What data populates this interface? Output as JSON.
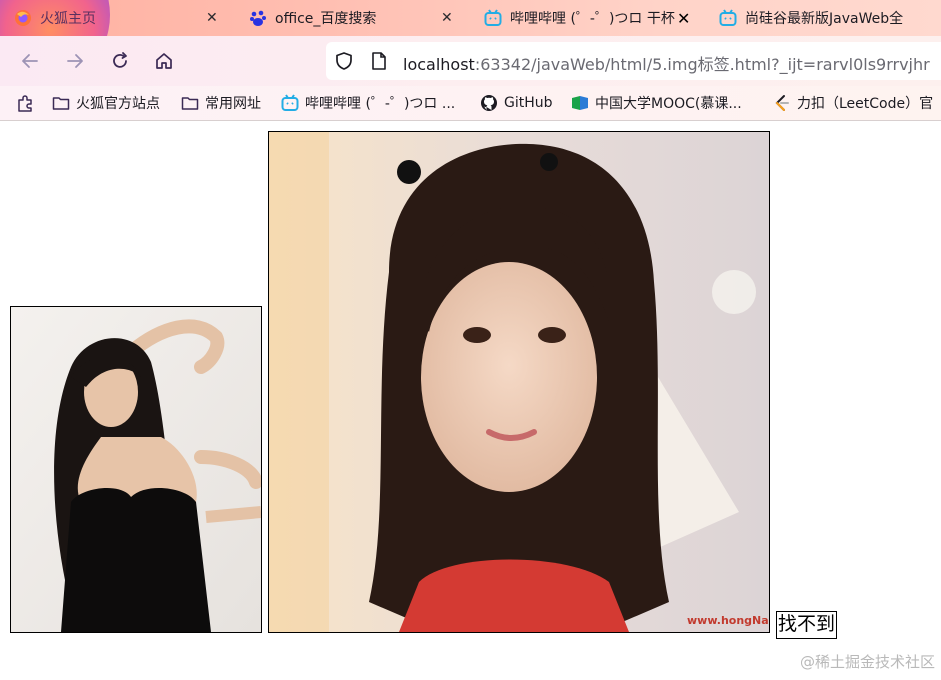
{
  "browser": {
    "tabs": [
      {
        "title": "火狐主页",
        "icon": "firefox-icon"
      },
      {
        "title": "office_百度搜索",
        "icon": "baidu-icon"
      },
      {
        "title": "哔哩哔哩 (゜-゜)つロ 干杯",
        "icon": "bilibili-icon"
      },
      {
        "title": "尚硅谷最新版JavaWeb全",
        "icon": "bilibili-icon"
      }
    ],
    "url": {
      "host": "localhost",
      "rest": ":63342/javaWeb/html/5.img标签.html?_ijt=rarvl0ls9rrvjhr"
    },
    "bookmarks": [
      {
        "label": "",
        "icon": "extension-icon"
      },
      {
        "label": "火狐官方站点",
        "icon": "folder-icon"
      },
      {
        "label": "常用网址",
        "icon": "folder-icon"
      },
      {
        "label": "哔哩哔哩 (゜-゜)つロ ...",
        "icon": "bilibili-icon"
      },
      {
        "label": "GitHub",
        "icon": "github-icon"
      },
      {
        "label": "中国大学MOOC(慕课...",
        "icon": "mooc-icon"
      },
      {
        "label": "力扣（LeetCode）官",
        "icon": "leetcode-icon"
      }
    ]
  },
  "page": {
    "broken_image_alt": "找不到",
    "large_image_watermark": "www.hongName.com"
  },
  "watermark": "@稀土掘金技术社区",
  "colors": {
    "bilibili": "#23ade5",
    "chrome_pink": "#ffc0b4",
    "link_gray": "#8a8a8a"
  }
}
